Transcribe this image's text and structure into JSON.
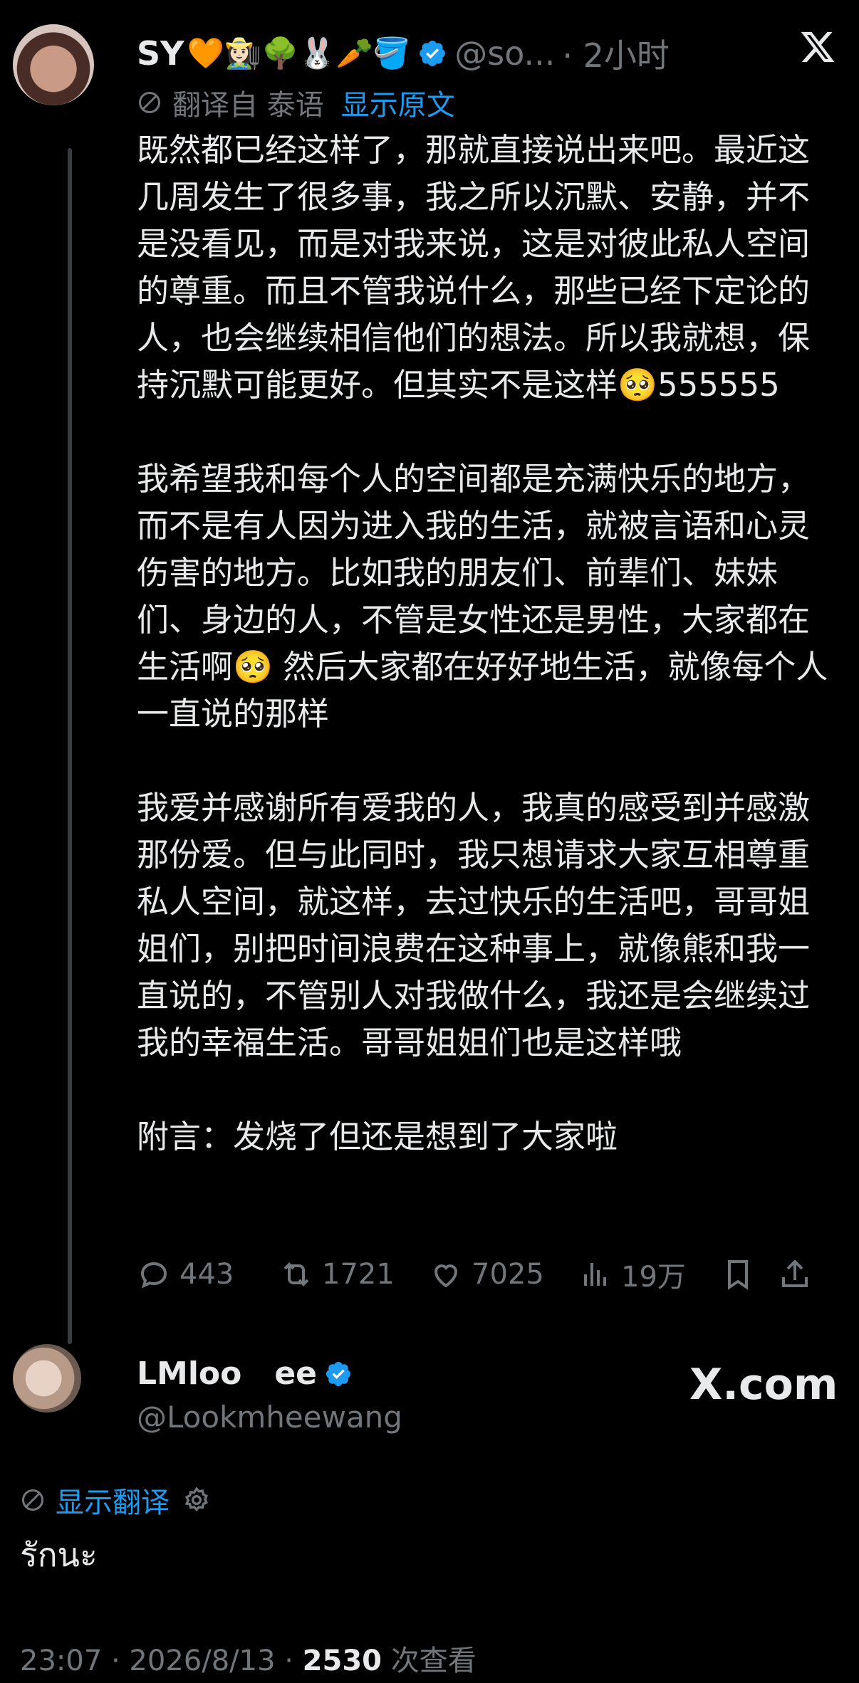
{
  "tweet": {
    "display_name": "SY",
    "name_emojis": "🧡👩🏻‍🌾🌳🐰🥕🪣",
    "handle": "@so...",
    "time": "· 2小时",
    "translated_from": "翻译自 泰语",
    "show_original": "显示原文",
    "paragraphs": [
      "既然都已经这样了，那就直接说出来吧。最近这几周发生了很多事，我之所以沉默、安静，并不是没看见，而是对我来说，这是对彼此私人空间的尊重。而且不管我说什么，那些已经下定论的人，也会继续相信他们的想法。所以我就想，保持沉默可能更好。但其实不是这样🥺555555",
      "我希望我和每个人的空间都是充满快乐的地方，而不是有人因为进入我的生活，就被言语和心灵伤害的地方。比如我的朋友们、前辈们、妹妹们、身边的人，不管是女性还是男性，大家都在生活啊🥺 然后大家都在好好地生活，就像每个人一直说的那样",
      "我爱并感谢所有爱我的人，我真的感受到并感激那份爱。但与此同时，我只想请求大家互相尊重私人空间，就这样，去过快乐的生活吧，哥哥姐姐们，别把时间浪费在这种事上，就像熊和我一直说的，不管别人对我做什么，我还是会继续过我的幸福生活。哥哥姐姐们也是这样哦",
      "附言：发烧了但还是想到了大家啦"
    ],
    "stats": {
      "replies": "443",
      "retweets": "1721",
      "likes": "7025",
      "views": "19万"
    }
  },
  "reply": {
    "display_name": "LMloo   ee",
    "handle": "@Lookmheewang",
    "watermark": "X.com",
    "show_translation": "显示翻译",
    "text": "รักนะ",
    "footer_time": "23:07 · 2026/8/13 ·",
    "footer_views": "2530",
    "footer_views_label": "次查看"
  },
  "colors": {
    "background": "#000000",
    "text": "#e7e9ea",
    "secondary": "#71767b",
    "accent": "#1d9bf0"
  },
  "icons": [
    "x-logo-icon",
    "verified-badge-icon",
    "translate-icon",
    "reply-icon",
    "retweet-icon",
    "like-icon",
    "views-icon",
    "bookmark-icon",
    "share-icon",
    "settings-icon"
  ]
}
